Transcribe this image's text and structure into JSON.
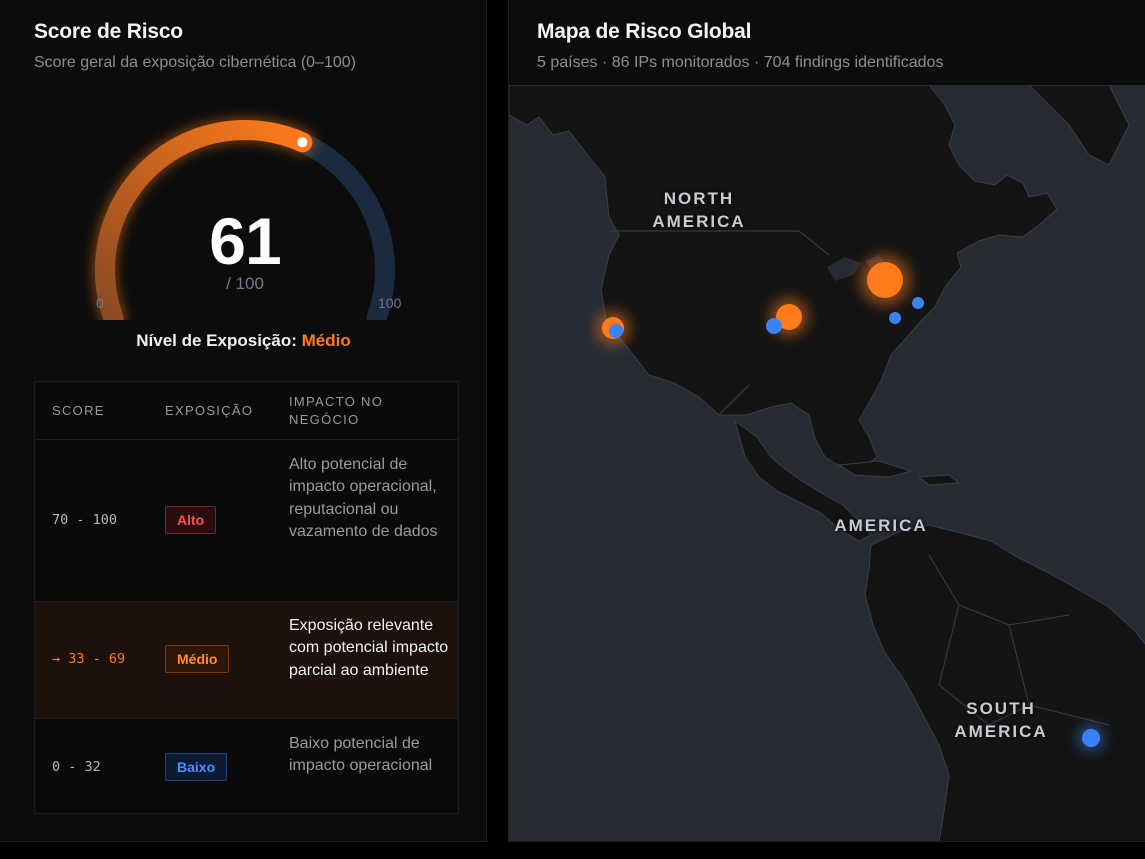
{
  "score_panel": {
    "title": "Score de Risco",
    "subtitle": "Score geral da exposição cibernética (0–100)",
    "gauge": {
      "value": 61,
      "value_text": "61",
      "max_text": "/ 100",
      "min_label": "0",
      "max_label": "100",
      "fill_fraction": 0.61,
      "fill_color": "#ff7a1a",
      "track_color": "#1c2a40"
    },
    "exposure_label": "Nível de Exposição:",
    "exposure_level": "Médio",
    "table": {
      "headers": [
        "SCORE",
        "EXPOSIÇÃO",
        "IMPACTO NO NEGÓCIO"
      ],
      "rows": [
        {
          "score": "70 - 100",
          "exposure": "Alto",
          "impact": "Alto potencial de impacto operacional, reputacional ou vazamento de dados",
          "active": false
        },
        {
          "score": "→ 33 - 69",
          "exposure": "Médio",
          "impact": "Exposição relevante com potencial impacto parcial ao ambiente",
          "active": true
        },
        {
          "score": "0 - 32",
          "exposure": "Baixo",
          "impact": "Baixo potencial de impacto operacional",
          "active": false
        }
      ]
    }
  },
  "map_panel": {
    "title": "Mapa de Risco Global",
    "subtitle": "5 países · 86 IPs monitorados · 704 findings identificados",
    "labels": {
      "north_america": [
        "NORTH",
        "AMERICA"
      ],
      "central_america": "AMERICA",
      "south_america": [
        "SOUTH",
        "AMERICA"
      ]
    },
    "colors": {
      "orange": "#ff7a1a",
      "blue": "#3b82f6",
      "land": "#141414",
      "water": "#262b33"
    }
  }
}
